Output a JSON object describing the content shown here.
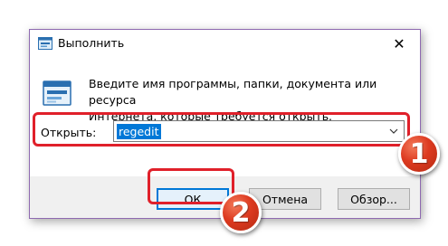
{
  "window": {
    "title": "Выполнить",
    "close_glyph": "✕"
  },
  "dialog": {
    "description": "Введите имя программы, папки, документа или ресурса\nИнтернета, которые требуется открыть.",
    "open_label": "Открыть:",
    "open_value": "regedit"
  },
  "buttons": {
    "ok": "ОК",
    "cancel": "Отмена",
    "browse": "Обзор..."
  },
  "annotations": {
    "step1": "1",
    "step2": "2",
    "highlight_color": "#e0202a",
    "badge_color": "#dd3a20"
  },
  "icons": {
    "title": "run-app-icon",
    "main": "run-app-icon",
    "dropdown": "chevron-down-icon",
    "close": "close-icon"
  }
}
